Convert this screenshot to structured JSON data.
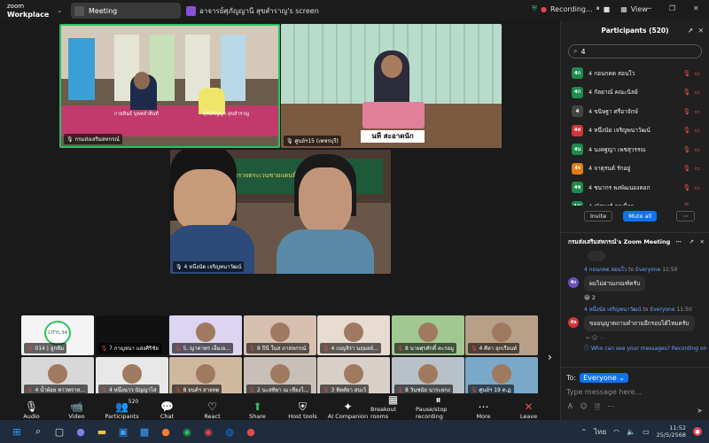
{
  "app": {
    "logo_line1": "zoom",
    "logo_line2": "Workplace",
    "meeting_label": "Meeting",
    "screen_title": "อาจารย์ศุภัญญานี สุขสำราญ's screen",
    "recording": "Recording...",
    "view": "View"
  },
  "colors": {
    "accent": "#0e72ed",
    "green": "#2dbf63",
    "red": "#e5484d"
  },
  "video": {
    "tile1_name": "กรมส่งเสริมสหกรณ์",
    "tile1_sub_a": "กายสินธ์ บุพหลำสินท์",
    "tile1_sub_b": "ศุลันรัญญา สุขสำราญ",
    "tile2_name": "ศูนย์ฯ15 (เพชรบุรี)",
    "tile2_sign": "นที สะอาดนัก",
    "tile3_name": "4 หนึ่งนัด เจริญพนาวัฒน์",
    "tile3_banner": "ตำรวจตระเวนชายแดนที่ 34"
  },
  "strip": [
    {
      "name": "014 | ลูกทีม",
      "extra": "CITYL 34"
    },
    {
      "name": "7 กาญจนา แสงศิริชัย"
    },
    {
      "name": "5. ญาดาพร เอ็มเอ..."
    },
    {
      "name": "8 ปีนี ในส ภาสหกรณ์"
    },
    {
      "name": "4 เบญจิรา นฤมลย์..."
    },
    {
      "name": "8 นายศุรศักดิ์ คะรอมู"
    },
    {
      "name": "4 ศิลา ลุกเรือนท์"
    },
    {
      "name": "4 น้ำผ้อย ทาวพราห..."
    },
    {
      "name": "4 หนึ่งนาว บัญญาไส"
    },
    {
      "name": "8 ยนต์ฯ สายทต"
    },
    {
      "name": "2 นะสทิยา ณ เชียงใ..."
    },
    {
      "name": "3 ทิดตัยา สนเว้"
    },
    {
      "name": "8 วันชนัย นาระยกง"
    },
    {
      "name": "ศูนย์ฯ 19 ต.ฏ"
    }
  ],
  "toolbar": [
    {
      "label": "Audio",
      "icon": "microphone-icon",
      "glyph": "🎙"
    },
    {
      "label": "Video",
      "icon": "camera-icon",
      "glyph": "📹"
    },
    {
      "label": "Participants",
      "icon": "people-icon",
      "glyph": "👥",
      "count": "520"
    },
    {
      "label": "Chat",
      "icon": "chat-icon",
      "glyph": "💬"
    },
    {
      "label": "React",
      "icon": "heart-icon",
      "glyph": "♡"
    },
    {
      "label": "Share",
      "icon": "share-icon",
      "glyph": "⬆"
    },
    {
      "label": "Host tools",
      "icon": "shield-icon",
      "glyph": "⛨"
    },
    {
      "label": "AI Companion",
      "icon": "sparkle-icon",
      "glyph": "✦"
    },
    {
      "label": "Breakout rooms",
      "icon": "grid-icon",
      "glyph": "▦"
    },
    {
      "label": "Pause/stop recording",
      "icon": "pause-icon",
      "glyph": "⏸"
    },
    {
      "label": "More",
      "icon": "more-icon",
      "glyph": "⋯"
    },
    {
      "label": "Leave",
      "icon": "leave-icon",
      "glyph": "✕"
    }
  ],
  "participants": {
    "title": "Participants (520)",
    "search_value": "4",
    "items": [
      {
        "initial": "4ก",
        "name": "4 กอนกคด สอนใว",
        "color": "#1e8a4c"
      },
      {
        "initial": "4ก",
        "name": "4 กัลยาณ์ คณะนิลย์",
        "color": "#1e8a4c"
      },
      {
        "initial": "4",
        "name": "4 ขนิษฐา ศรีอาจักษ์",
        "color": "#444"
      },
      {
        "initial": "4ห",
        "name": "4 หนึ่งนัย เจริญพนาวัฒน์",
        "color": "#d0353a"
      },
      {
        "initial": "4น",
        "name": "4 นงคฐญา เพชสุวรรณ",
        "color": "#1e8a4c"
      },
      {
        "initial": "4จ",
        "name": "4 จาตุรนต์ รักอยู่",
        "color": "#e07b16"
      },
      {
        "initial": "4ช",
        "name": "4 ชนากร พงพัฒนองคอก",
        "color": "#1e8a4c"
      },
      {
        "initial": "4ณ",
        "name": "4 ณัฐพงศ์ กาเนื่อย",
        "color": "#1e8a4c"
      }
    ],
    "invite": "Invite",
    "mute_all": "Mute all"
  },
  "chat": {
    "title": "กรมส่งเสริมสหกรณ์'s Zoom Meeting",
    "messages": [
      {
        "sender": "4 กอนกคด สอนใว",
        "to": "Everyone",
        "time": "11:50",
        "initial": "4ก",
        "color": "#6a4fbf",
        "text": "ผมไม่ผ่านเกณฑ์ครับ",
        "reaction": "😀 2"
      },
      {
        "sender": "4 หนึ่งนัย เจริญพนาวัฒน์",
        "to": "Everyone",
        "time": "11:50",
        "initial": "4ห",
        "color": "#d0353a",
        "text": "ขออนุญาตถามคำถามอีกรอบได้ไหมครับ"
      }
    ],
    "who_can_see": "Who can see your messages? Recording on",
    "to_label": "To:",
    "to_value": "Everyone",
    "placeholder": "Type message here..."
  },
  "taskbar": {
    "lang": "ไทย",
    "time": "11:52",
    "date": "25/5/2568"
  }
}
